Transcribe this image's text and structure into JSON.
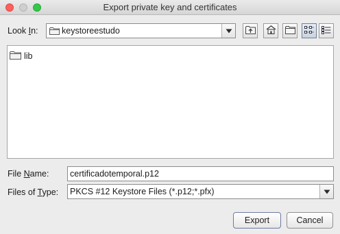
{
  "window": {
    "title": "Export private key and certificates"
  },
  "look_in": {
    "label_pre": "Look ",
    "label_mnemonic": "I",
    "label_post": "n:",
    "value": "keystoreestudo"
  },
  "files": [
    {
      "name": "lib",
      "icon": "folder-icon"
    }
  ],
  "file_name": {
    "label_pre": "File ",
    "label_mnemonic": "N",
    "label_post": "ame:",
    "value": "certificadotemporal.p12"
  },
  "files_of_type": {
    "label_pre": "Files of ",
    "label_mnemonic": "T",
    "label_post": "ype:",
    "value": "PKCS #12 Keystore Files (*.p12;*.pfx)"
  },
  "buttons": {
    "export": "Export",
    "cancel": "Cancel"
  },
  "toolbar": {
    "view_mode": "list"
  }
}
